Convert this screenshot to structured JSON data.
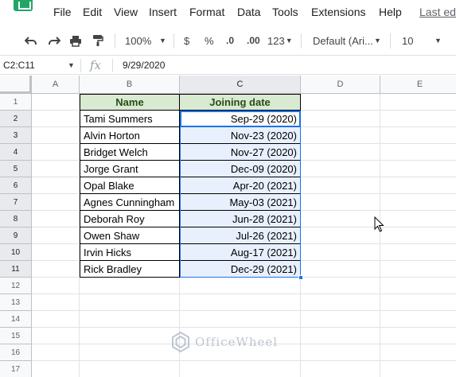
{
  "menu": {
    "items": [
      "File",
      "Edit",
      "View",
      "Insert",
      "Format",
      "Data",
      "Tools",
      "Extensions",
      "Help"
    ],
    "last_edit": "Last ed"
  },
  "toolbar": {
    "zoom": "100%",
    "currency": "$",
    "percent": "%",
    "dec_decrease": ".0",
    "dec_increase": ".00",
    "more_formats": "123",
    "font": "Default (Ari...",
    "font_size": "10"
  },
  "formula_bar": {
    "name_box": "C2:C11",
    "fx": "fx",
    "value": "9/29/2020"
  },
  "columns": [
    "A",
    "B",
    "C",
    "D",
    "E"
  ],
  "rows": [
    "1",
    "2",
    "3",
    "4",
    "5",
    "6",
    "7",
    "8",
    "9",
    "10",
    "11",
    "12",
    "13",
    "14",
    "15",
    "16",
    "17"
  ],
  "table": {
    "headers": [
      "Name",
      "Joining date"
    ],
    "rows": [
      [
        "Tami Summers",
        "Sep-29 (2020)"
      ],
      [
        "Alvin Horton",
        "Nov-23 (2020)"
      ],
      [
        "Bridget Welch",
        "Nov-27 (2020)"
      ],
      [
        "Jorge Grant",
        "Dec-09 (2020)"
      ],
      [
        "Opal Blake",
        "Apr-20 (2021)"
      ],
      [
        "Agnes Cunningham",
        "May-03 (2021)"
      ],
      [
        "Deborah Roy",
        "Jun-28 (2021)"
      ],
      [
        "Owen Shaw",
        "Jul-26 (2021)"
      ],
      [
        "Irvin Hicks",
        "Aug-17 (2021)"
      ],
      [
        "Rick Bradley",
        "Dec-29 (2021)"
      ]
    ]
  },
  "watermark": "OfficeWheel",
  "colors": {
    "header_fill": "#d9ead3",
    "header_text": "#274e13",
    "selection_fill": "#e8f0fe",
    "selection_border": "#1a73e8",
    "logo": "#23a566"
  }
}
